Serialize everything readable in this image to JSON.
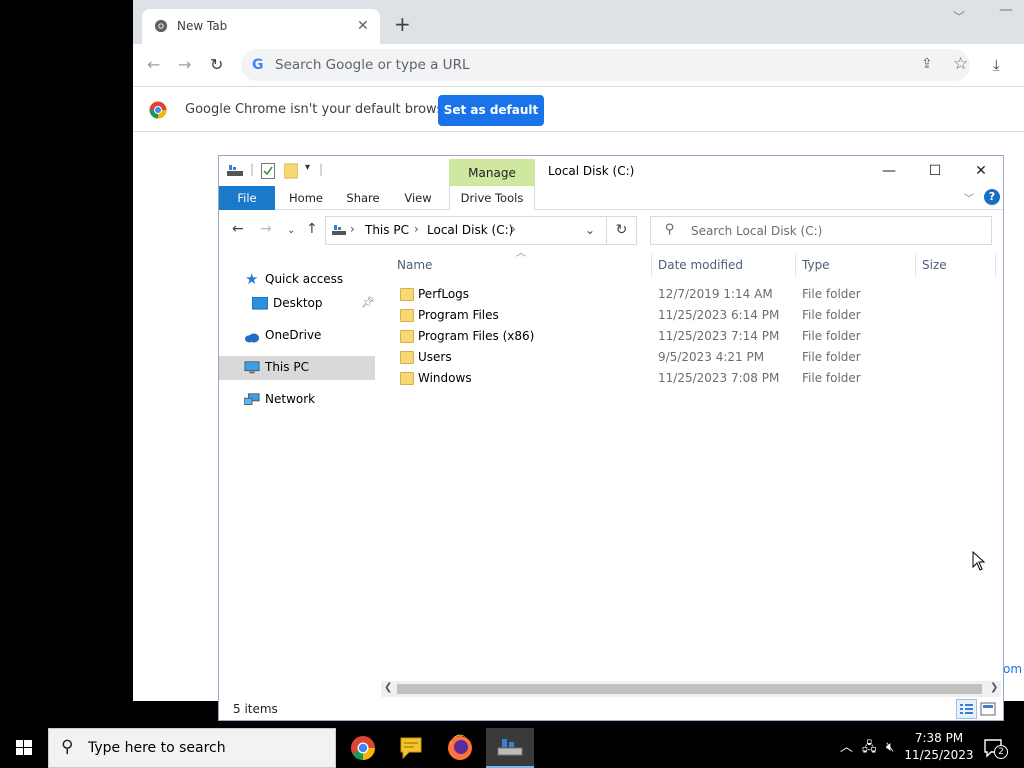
{
  "chrome": {
    "tab_title": "New Tab",
    "tab_close": "✕",
    "new_tab": "+",
    "omnibox_placeholder": "Search Google or type a URL",
    "infobar_text": "Google Chrome isn't your default browser",
    "set_default_label": "Set as default",
    "ghost_text": "om"
  },
  "explorer": {
    "manage_label": "Manage",
    "title": "Local Disk (C:)",
    "ribbon_tabs": [
      "File",
      "Home",
      "Share",
      "View",
      "Drive Tools"
    ],
    "breadcrumb": [
      "This PC",
      "Local Disk (C:)"
    ],
    "search_placeholder": "Search Local Disk (C:)",
    "nav": {
      "quick_access": "Quick access",
      "desktop": "Desktop",
      "onedrive": "OneDrive",
      "this_pc": "This PC",
      "network": "Network"
    },
    "columns": [
      "Name",
      "Date modified",
      "Type",
      "Size"
    ],
    "files": [
      {
        "name": "PerfLogs",
        "date": "12/7/2019 1:14 AM",
        "type": "File folder"
      },
      {
        "name": "Program Files",
        "date": "11/25/2023 6:14 PM",
        "type": "File folder"
      },
      {
        "name": "Program Files (x86)",
        "date": "11/25/2023 7:14 PM",
        "type": "File folder"
      },
      {
        "name": "Users",
        "date": "9/5/2023 4:21 PM",
        "type": "File folder"
      },
      {
        "name": "Windows",
        "date": "11/25/2023 7:08 PM",
        "type": "File folder"
      }
    ],
    "status_count": "5 items"
  },
  "taskbar": {
    "search_placeholder": "Type here to search",
    "time": "7:38 PM",
    "date": "11/25/2023",
    "notification_count": "2"
  },
  "colors": {
    "chrome_blue": "#1a73e8",
    "file_tab_blue": "#1979ca",
    "manage_green": "#d0e7a0",
    "folder_yellow": "#f8d775"
  }
}
